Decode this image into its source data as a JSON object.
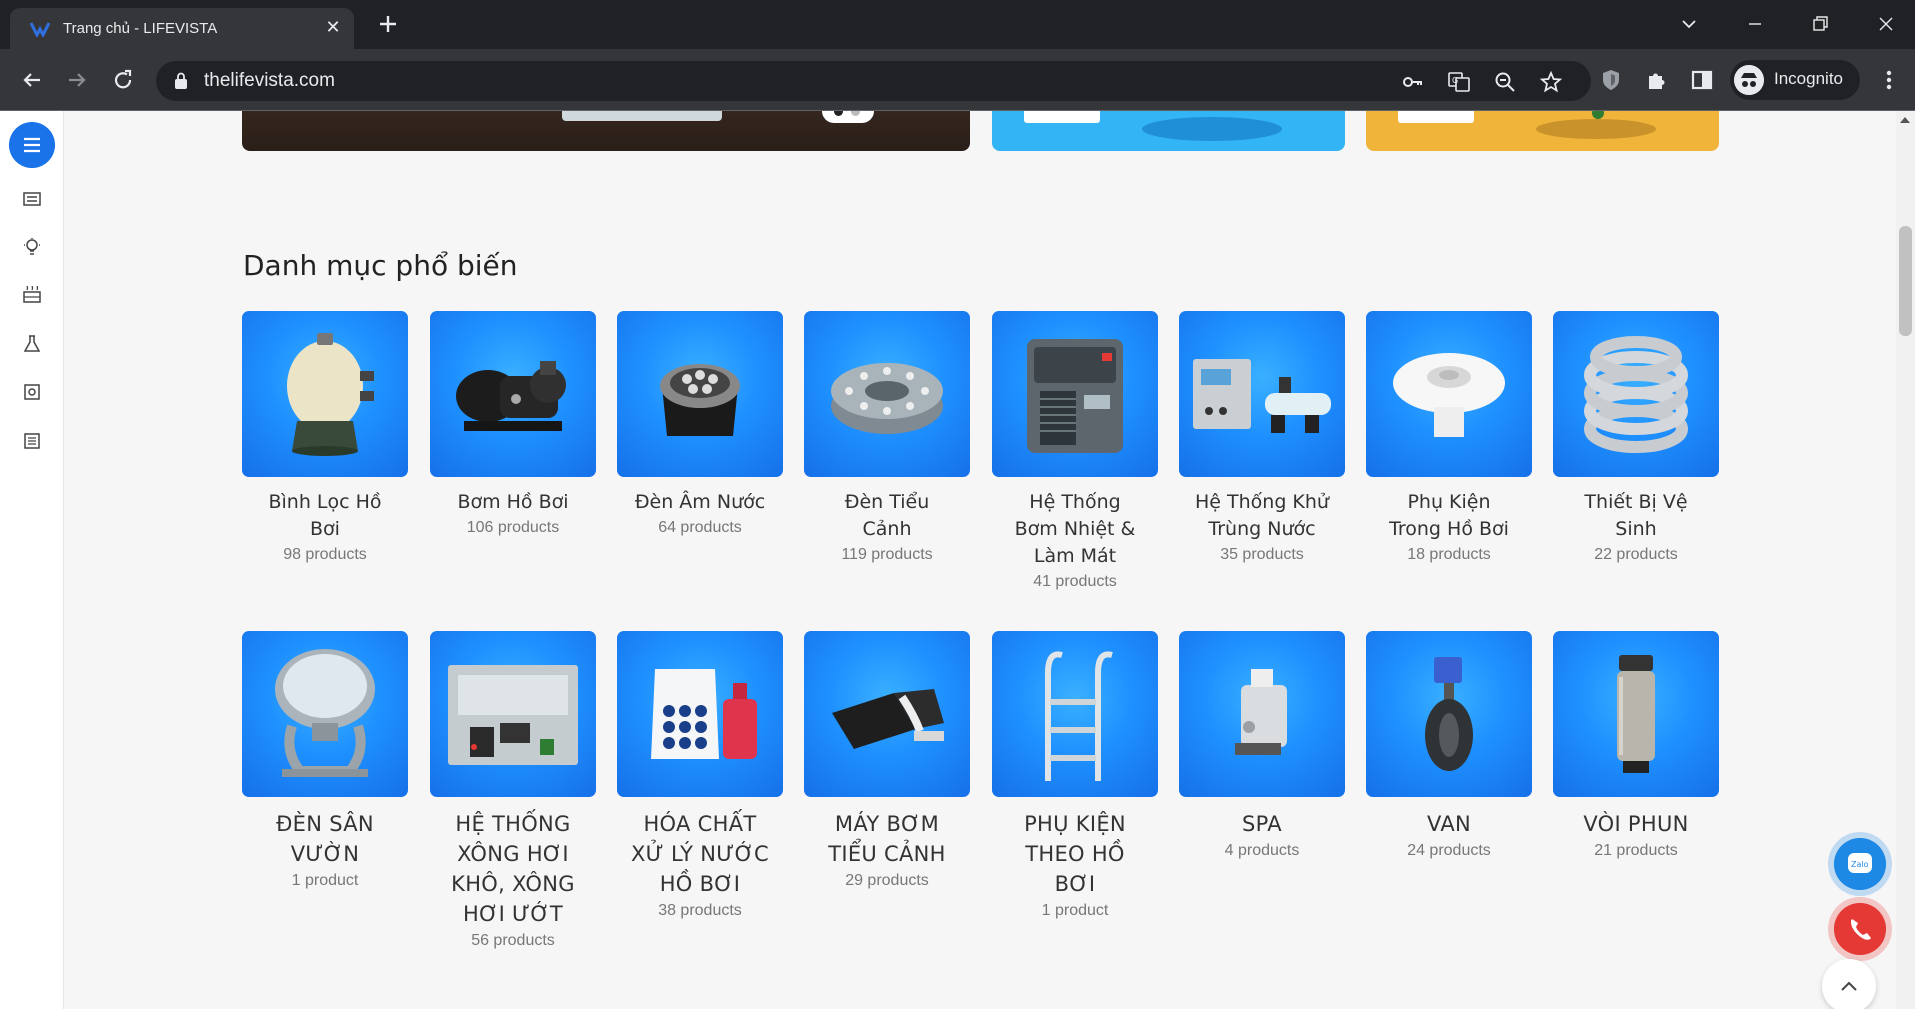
{
  "browser": {
    "tab_title": "Trang chủ - LIFEVISTA",
    "url": "thelifevista.com",
    "profile_label": "Incognito"
  },
  "page": {
    "section_title": "Danh mục phổ biến",
    "row1": [
      {
        "name": "Bình Lọc Hồ Bơi",
        "count": "98 products",
        "icon": "sand-filter-tank"
      },
      {
        "name": "Bơm Hồ Bơi",
        "count": "106 products",
        "icon": "pool-pump"
      },
      {
        "name": "Đèn Âm Nước",
        "count": "64 products",
        "icon": "underwater-light"
      },
      {
        "name": "Đèn Tiểu Cảnh",
        "count": "119 products",
        "icon": "ring-fountain-light"
      },
      {
        "name": "Hệ Thống Bơm Nhiệt & Làm Mát",
        "count": "41 products",
        "icon": "heat-pump"
      },
      {
        "name": "Hệ Thống Khử Trùng Nước",
        "count": "35 products",
        "icon": "chlorinator"
      },
      {
        "name": "Phụ Kiện Trong Hồ Bơi",
        "count": "18 products",
        "icon": "wall-inlet"
      },
      {
        "name": "Thiết Bị Vệ Sinh",
        "count": "22 products",
        "icon": "vacuum-hose"
      }
    ],
    "row2": [
      {
        "name": "ĐÈN SÂN VƯỜN",
        "count": "1 product",
        "icon": "garden-spotlight"
      },
      {
        "name": "HỆ THỐNG XÔNG HƠI KHÔ, XÔNG HƠI ƯỚT",
        "count": "56 products",
        "icon": "steam-generator"
      },
      {
        "name": "HÓA CHẤT XỬ LÝ NƯỚC HỒ BƠI",
        "count": "38 products",
        "icon": "chemicals"
      },
      {
        "name": "MÁY BƠM TIỂU CẢNH",
        "count": "29 products",
        "icon": "fountain-pump"
      },
      {
        "name": "PHỤ KIỆN THEO HỒ BƠI",
        "count": "1 product",
        "icon": "pool-ladder"
      },
      {
        "name": "SPA",
        "count": "4 products",
        "icon": "spa-jet"
      },
      {
        "name": "VAN",
        "count": "24 products",
        "icon": "butterfly-valve"
      },
      {
        "name": "VÒI PHUN",
        "count": "21 products",
        "icon": "water-nozzle"
      }
    ]
  },
  "colors": {
    "accent": "#1a73e8",
    "card_blue": "#1e90ff",
    "call_red": "#e53935"
  }
}
